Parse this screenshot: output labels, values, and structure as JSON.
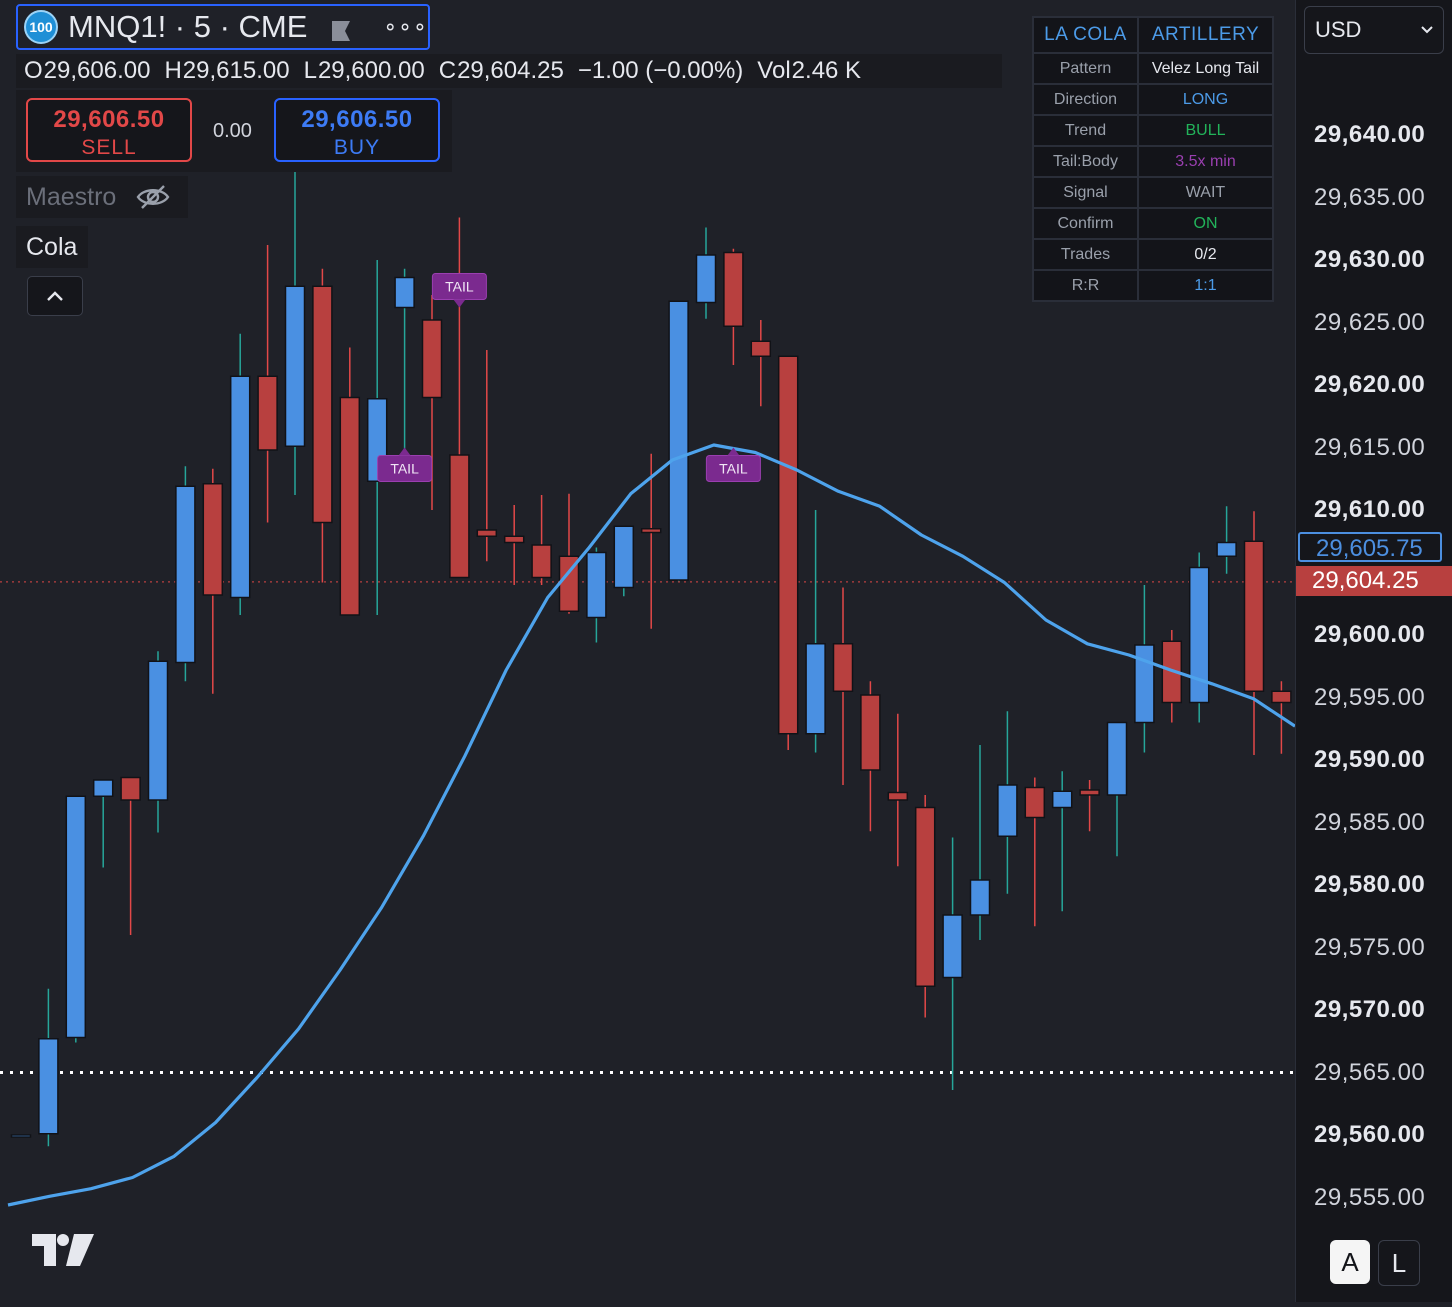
{
  "symbol": {
    "badge": "100",
    "title": "MNQ1! · 5 · CME",
    "more": "∘∘∘"
  },
  "ohlc": {
    "open_label": "O",
    "open": "29,606.00",
    "high_label": "H",
    "high": "29,615.00",
    "low_label": "L",
    "low": "29,600.00",
    "close_label": "C",
    "close": "29,604.25",
    "change": "−1.00 (−0.00%)",
    "vol_label": "Vol",
    "vol": "2.46 K"
  },
  "trade": {
    "sell_price": "29,606.50",
    "sell_label": "SELL",
    "spread": "0.00",
    "buy_price": "29,606.50",
    "buy_label": "BUY"
  },
  "studies": {
    "maestro": "Maestro",
    "cola": "Cola"
  },
  "info_table": {
    "header_left": "LA COLA",
    "header_right": "ARTILLERY",
    "rows": [
      {
        "label": "Pattern",
        "value": "Velez Long Tail",
        "color": "#e6e8ee"
      },
      {
        "label": "Direction",
        "value": "LONG",
        "color": "#4c9be8"
      },
      {
        "label": "Trend",
        "value": "BULL",
        "color": "#22b35a"
      },
      {
        "label": "Tail:Body",
        "value": "3.5x min",
        "color": "#9a3fb0"
      },
      {
        "label": "Signal",
        "value": "WAIT",
        "color": "#9aa0ab"
      },
      {
        "label": "Confirm",
        "value": "ON",
        "color": "#22b35a"
      },
      {
        "label": "Trades",
        "value": "0/2",
        "color": "#e6e8ee"
      },
      {
        "label": "R:R",
        "value": "1:1",
        "color": "#4c9be8"
      }
    ]
  },
  "axis": {
    "currency": "USD",
    "ticks": [
      {
        "value": 29640,
        "label": "29,640.00",
        "major": true
      },
      {
        "value": 29635,
        "label": "29,635.00",
        "major": false
      },
      {
        "value": 29630,
        "label": "29,630.00",
        "major": true
      },
      {
        "value": 29625,
        "label": "29,625.00",
        "major": false
      },
      {
        "value": 29620,
        "label": "29,620.00",
        "major": true
      },
      {
        "value": 29615,
        "label": "29,615.00",
        "major": false
      },
      {
        "value": 29610,
        "label": "29,610.00",
        "major": true
      },
      {
        "value": 29600,
        "label": "29,600.00",
        "major": true
      },
      {
        "value": 29595,
        "label": "29,595.00",
        "major": false
      },
      {
        "value": 29590,
        "label": "29,590.00",
        "major": true
      },
      {
        "value": 29585,
        "label": "29,585.00",
        "major": false
      },
      {
        "value": 29580,
        "label": "29,580.00",
        "major": true
      },
      {
        "value": 29575,
        "label": "29,575.00",
        "major": false
      },
      {
        "value": 29570,
        "label": "29,570.00",
        "major": true
      },
      {
        "value": 29565,
        "label": "29,565.00",
        "major": false
      },
      {
        "value": 29560,
        "label": "29,560.00",
        "major": true
      },
      {
        "value": 29555,
        "label": "29,555.00",
        "major": false
      }
    ],
    "ask_tag": "29,605.75",
    "last_tag": "29,604.25",
    "btn_auto": "A",
    "btn_log": "L"
  },
  "chart_data": {
    "type": "candlestick",
    "up_color": "#4a90e2",
    "down_color": "#b8403f",
    "wick_up_color": "#26a69a",
    "wick_down_color": "#e24848",
    "last_price_line": 29604.25,
    "support_line": 29565,
    "candles": [
      {
        "o": 29560.0,
        "h": 29560.0,
        "l": 29560.0,
        "c": 29560.0
      },
      {
        "o": 29560.1,
        "h": 29571.7,
        "l": 29559.1,
        "c": 29567.7
      },
      {
        "o": 29567.8,
        "h": 29586.8,
        "l": 29567.4,
        "c": 29587.1
      },
      {
        "o": 29587.1,
        "h": 29588.4,
        "l": 29581.4,
        "c": 29588.4
      },
      {
        "o": 29588.6,
        "h": 29588.6,
        "l": 29576.0,
        "c": 29586.8
      },
      {
        "o": 29586.8,
        "h": 29598.7,
        "l": 29584.2,
        "c": 29597.9
      },
      {
        "o": 29597.8,
        "h": 29613.5,
        "l": 29596.3,
        "c": 29611.9
      },
      {
        "o": 29612.1,
        "h": 29613.3,
        "l": 29595.3,
        "c": 29603.2
      },
      {
        "o": 29603.0,
        "h": 29624.1,
        "l": 29601.6,
        "c": 29620.7
      },
      {
        "o": 29620.7,
        "h": 29631.2,
        "l": 29609.0,
        "c": 29614.8
      },
      {
        "o": 29615.1,
        "h": 29643.6,
        "l": 29611.2,
        "c": 29627.9
      },
      {
        "o": 29627.9,
        "h": 29629.3,
        "l": 29604.2,
        "c": 29609.0
      },
      {
        "o": 29619.0,
        "h": 29623.0,
        "l": 29601.6,
        "c": 29601.6
      },
      {
        "o": 29612.3,
        "h": 29630.0,
        "l": 29601.6,
        "c": 29618.9
      },
      {
        "o": 29626.2,
        "h": 29629.3,
        "l": 29614.0,
        "c": 29628.6
      },
      {
        "o": 29625.2,
        "h": 29627.2,
        "l": 29610.0,
        "c": 29619.0
      },
      {
        "o": 29614.4,
        "h": 29633.4,
        "l": 29607.1,
        "c": 29604.6
      },
      {
        "o": 29608.4,
        "h": 29622.8,
        "l": 29605.9,
        "c": 29607.9
      },
      {
        "o": 29607.9,
        "h": 29610.4,
        "l": 29604.0,
        "c": 29607.4
      },
      {
        "o": 29607.2,
        "h": 29611.2,
        "l": 29604.0,
        "c": 29604.6
      },
      {
        "o": 29606.3,
        "h": 29611.3,
        "l": 29601.7,
        "c": 29601.9
      },
      {
        "o": 29601.4,
        "h": 29607.0,
        "l": 29599.4,
        "c": 29606.6
      },
      {
        "o": 29603.8,
        "h": 29608.7,
        "l": 29603.1,
        "c": 29608.7
      },
      {
        "o": 29608.5,
        "h": 29614.5,
        "l": 29600.5,
        "c": 29608.2
      },
      {
        "o": 29604.4,
        "h": 29625.2,
        "l": 29604.3,
        "c": 29626.7
      },
      {
        "o": 29626.6,
        "h": 29632.6,
        "l": 29625.3,
        "c": 29630.4
      },
      {
        "o": 29630.6,
        "h": 29630.9,
        "l": 29621.6,
        "c": 29624.7
      },
      {
        "o": 29623.5,
        "h": 29625.2,
        "l": 29618.3,
        "c": 29622.3
      },
      {
        "o": 29622.3,
        "h": 29622.3,
        "l": 29590.8,
        "c": 29592.1
      },
      {
        "o": 29592.1,
        "h": 29610.0,
        "l": 29590.6,
        "c": 29599.3
      },
      {
        "o": 29599.3,
        "h": 29603.8,
        "l": 29588.0,
        "c": 29595.5
      },
      {
        "o": 29595.2,
        "h": 29596.3,
        "l": 29584.3,
        "c": 29589.2
      },
      {
        "o": 29587.4,
        "h": 29593.7,
        "l": 29581.5,
        "c": 29586.8
      },
      {
        "o": 29586.2,
        "h": 29587.2,
        "l": 29569.4,
        "c": 29571.9
      },
      {
        "o": 29572.6,
        "h": 29583.8,
        "l": 29563.6,
        "c": 29577.6
      },
      {
        "o": 29577.6,
        "h": 29591.2,
        "l": 29575.6,
        "c": 29580.4
      },
      {
        "o": 29583.9,
        "h": 29593.9,
        "l": 29579.3,
        "c": 29588.0
      },
      {
        "o": 29587.8,
        "h": 29588.6,
        "l": 29576.7,
        "c": 29585.4
      },
      {
        "o": 29586.2,
        "h": 29589.1,
        "l": 29577.9,
        "c": 29587.5
      },
      {
        "o": 29587.6,
        "h": 29588.4,
        "l": 29584.3,
        "c": 29587.2
      },
      {
        "o": 29587.2,
        "h": 29591.7,
        "l": 29582.3,
        "c": 29593.0
      },
      {
        "o": 29593.0,
        "h": 29604.0,
        "l": 29590.6,
        "c": 29599.2
      },
      {
        "o": 29599.5,
        "h": 29600.4,
        "l": 29593.0,
        "c": 29594.6
      },
      {
        "o": 29594.6,
        "h": 29606.6,
        "l": 29593.0,
        "c": 29605.4
      },
      {
        "o": 29606.3,
        "h": 29610.3,
        "l": 29604.9,
        "c": 29607.4
      },
      {
        "o": 29607.5,
        "h": 29609.9,
        "l": 29590.4,
        "c": 29595.5
      },
      {
        "o": 29595.5,
        "h": 29596.3,
        "l": 29590.5,
        "c": 29594.6
      },
      {
        "o": 29594.5,
        "h": 29606.1,
        "l": 29592.9,
        "c": 29605.4
      }
    ],
    "ema": [
      29554.4,
      29555.1,
      29555.7,
      29556.6,
      29558.3,
      29561.0,
      29564.6,
      29568.5,
      29573.2,
      29578.2,
      29583.9,
      29590.3,
      29597.2,
      29603.0,
      29607.0,
      29611.3,
      29614.0,
      29615.2,
      29614.6,
      29613.2,
      29611.5,
      29610.3,
      29608.0,
      29606.3,
      29604.2,
      29601.2,
      29599.3,
      29598.4,
      29597.2,
      29596.1,
      29594.9,
      29592.7
    ],
    "markers": [
      {
        "label": "TAIL",
        "candle": 16,
        "value": 29626.2,
        "direction": "down"
      },
      {
        "label": "TAIL",
        "candle": 14,
        "value": 29615.0,
        "direction": "up"
      },
      {
        "label": "TAIL",
        "candle": 26,
        "value": 29615.0,
        "direction": "up"
      }
    ]
  }
}
